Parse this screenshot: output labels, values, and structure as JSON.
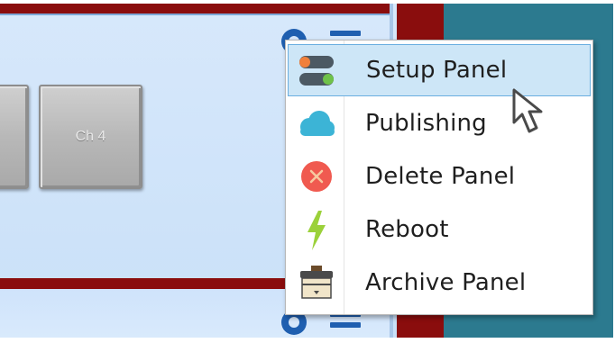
{
  "channel_buttons": [
    {
      "label": ""
    },
    {
      "label": "Ch 4"
    }
  ],
  "context_menu": {
    "items": [
      {
        "label": "Setup Panel",
        "icon": "toggle-switches-icon",
        "selected": true
      },
      {
        "label": "Publishing",
        "icon": "cloud-icon",
        "selected": false
      },
      {
        "label": "Delete Panel",
        "icon": "delete-x-icon",
        "selected": false
      },
      {
        "label": "Reboot",
        "icon": "lightning-bolt-icon",
        "selected": false
      },
      {
        "label": "Archive Panel",
        "icon": "archive-box-icon",
        "selected": false
      }
    ]
  },
  "colors": {
    "panel_background": "#d7e8fb",
    "panel_border": "#8a0d0d",
    "teal_background": "#2c7a8f",
    "selection_background": "#cde6f7",
    "selection_border": "#6aaee0",
    "icon_blue": "#1f5fb0"
  }
}
